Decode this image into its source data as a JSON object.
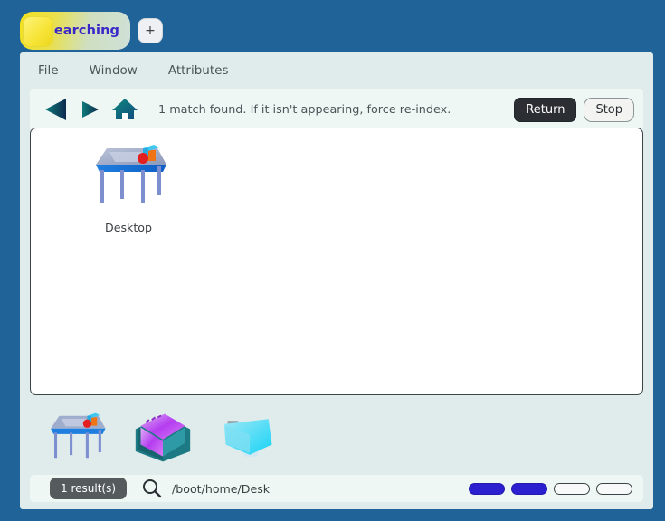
{
  "window": {
    "tab": {
      "label": "Searching",
      "add_label": "+",
      "swatch": "tab-color-swatch"
    },
    "menu": {
      "items": [
        {
          "label": "File"
        },
        {
          "label": "Window"
        },
        {
          "label": "Attributes"
        }
      ]
    },
    "toolbar": {
      "back_icon": "back-arrow-icon",
      "forward_icon": "forward-arrow-icon",
      "home_icon": "home-icon",
      "status": "1 match found. If it isn't appearing, force re-index.",
      "return_label": "Return",
      "stop_label": "Stop"
    },
    "content": {
      "items": [
        {
          "label": "Desktop",
          "icon": "desk-icon"
        }
      ]
    },
    "shelf": {
      "items": [
        {
          "icon": "desk-icon",
          "name": "shelf-icon-desktop"
        },
        {
          "icon": "file-box-icon",
          "name": "shelf-icon-filebox"
        },
        {
          "icon": "folder-icon",
          "name": "shelf-icon-folder"
        }
      ]
    },
    "statusbar": {
      "result_badge": "1 result(s)",
      "search_icon": "magnifier-icon",
      "path": "/boot/home/Desk",
      "progress_pips": [
        "on",
        "on",
        "off",
        "off"
      ]
    }
  },
  "colors": {
    "desktop_background": "#1f6399",
    "window_background": "#dfeceb",
    "toolbar_background": "#eef7f4",
    "panel_background": "#ffffff",
    "accent_blue": "#2b1fd0",
    "tab_text": "#3a27c8",
    "badge_background": "#555b5c"
  }
}
